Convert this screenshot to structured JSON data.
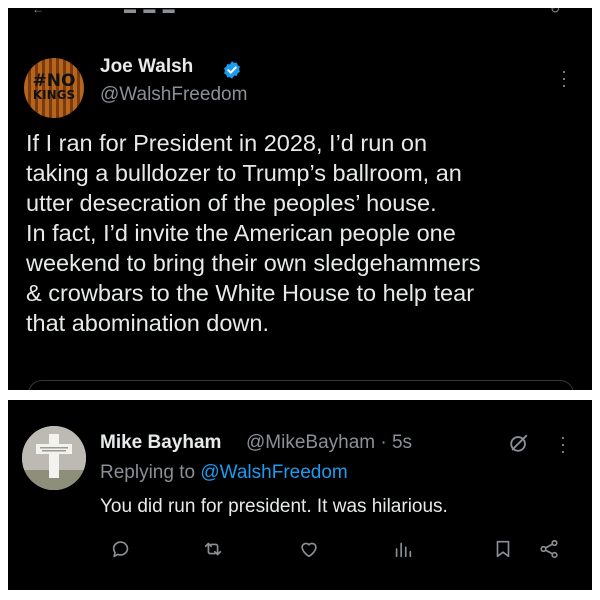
{
  "top_post": {
    "author_name": "Joe Walsh",
    "author_handle": "@WalshFreedom",
    "avatar_text": [
      "#NO",
      "KINGS"
    ],
    "verified_color": "#1d9bf0",
    "body": "If I ran for President in 2028, I’d run on\ntaking a bulldozer to Trump’s ballroom, an\nutter desecration of the peoples’ house.\nIn fact, I’d invite the American people one\nweekend to bring their own sledgehammers\n& crowbars to the White House to help tear\nthat abomination down."
  },
  "reply_post": {
    "author_name": "Mike Bayham",
    "handle_time": "@MikeBayham · 5s",
    "replying_to_prefix": "Replying to",
    "replying_to_mention": "@WalshFreedom",
    "body": "You did run for president. It was hilarious.",
    "actions": [
      "reply-icon",
      "repost-icon",
      "like-icon",
      "views-icon",
      "bookmark-icon",
      "share-icon"
    ]
  },
  "colors": {
    "background": "#000000",
    "text": "#e7e9ea",
    "muted": "#8b9097",
    "accent": "#1d9bf0"
  }
}
